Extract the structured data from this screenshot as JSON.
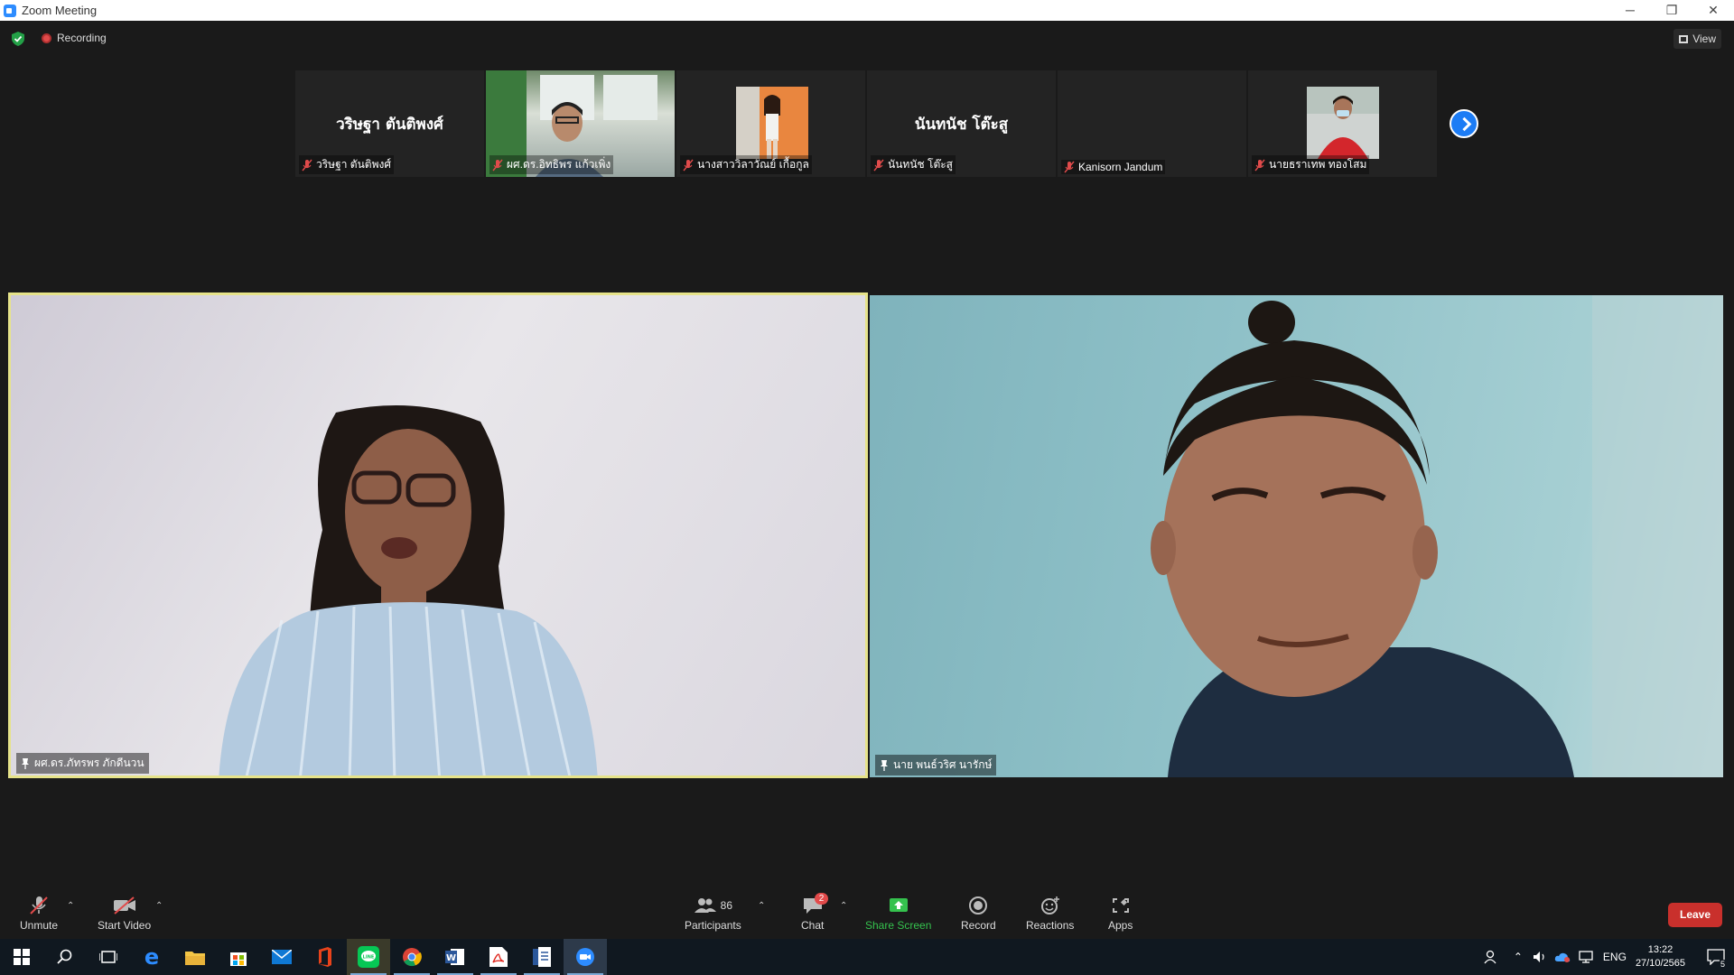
{
  "window": {
    "title": "Zoom Meeting",
    "minimize": "─",
    "restore": "❐",
    "close": "✕"
  },
  "topbar": {
    "recording_label": "Recording",
    "view_label": "View"
  },
  "thumbnails": [
    {
      "big_name": "วริษฐา ตันติพงศ์",
      "label": "วริษฐา ตันติพงศ์"
    },
    {
      "big_name": "",
      "label": "ผศ.ดร.อิทธิพร แก้วเพิ่ง"
    },
    {
      "big_name": "",
      "label": "นางสาววิลาวัณย์ เกื้อกูล"
    },
    {
      "big_name": "นันทนัช โต๊ะสู",
      "label": "นันทนัช โต๊ะสู"
    },
    {
      "big_name": "",
      "label": "Kanisorn  Jandum"
    },
    {
      "big_name": "",
      "label": "นายธราเทพ ทองโสม"
    }
  ],
  "videos": [
    {
      "label": "ผศ.ดร.ภัทรพร ภักดีนวน"
    },
    {
      "label": "นาย พนธ์วริศ นารักษ์"
    }
  ],
  "toolbar": {
    "unmute": "Unmute",
    "start_video": "Start Video",
    "participants": "Participants",
    "participants_count": "86",
    "chat": "Chat",
    "chat_badge": "2",
    "share_screen": "Share Screen",
    "record": "Record",
    "reactions": "Reactions",
    "apps": "Apps",
    "leave": "Leave",
    "colors": {
      "share": "#35c24e",
      "leave": "#c9302c",
      "accent": "#1c7cf5"
    }
  },
  "taskbar": {
    "language": "ENG",
    "time": "13:22",
    "date": "27/10/2565",
    "notification_count": "5"
  }
}
